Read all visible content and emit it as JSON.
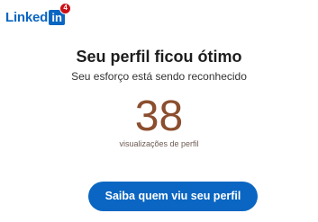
{
  "header": {
    "logo_text": "Linked",
    "logo_box_text": "in",
    "notification_count": "4"
  },
  "card": {
    "title": "Seu perfil ficou ótimo",
    "subtitle": "Seu esforço está sendo reconhecido",
    "profile_views": "38",
    "profile_views_label": "visualizações de perfil",
    "cta_label": "Saiba quem viu seu perfil"
  },
  "colors": {
    "brand_blue": "#0a66c2",
    "count_color": "#8b4e2e",
    "badge_red": "#cc1016"
  }
}
